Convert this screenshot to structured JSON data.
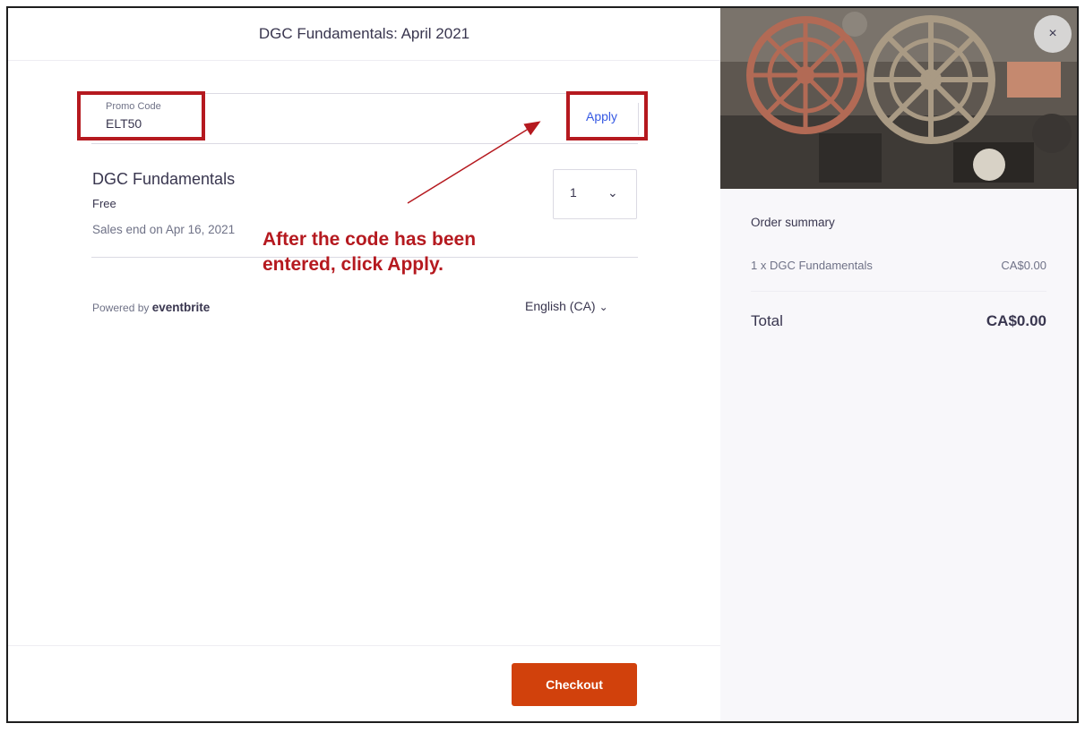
{
  "header": {
    "title": "DGC Fundamentals: April 2021"
  },
  "promo": {
    "label": "Promo Code",
    "value": "ELT50",
    "apply_label": "Apply"
  },
  "ticket": {
    "name": "DGC Fundamentals",
    "price": "Free",
    "sales_end": "Sales end on Apr 16, 2021",
    "quantity": "1"
  },
  "footer": {
    "powered_by": "Powered by",
    "brand": "eventbrite",
    "language": "English (CA)",
    "checkout_label": "Checkout"
  },
  "annotation": {
    "line1": "After the code has been",
    "line2": "entered, click Apply."
  },
  "order_summary": {
    "title": "Order summary",
    "item_label": "1 x DGC Fundamentals",
    "item_price": "CA$0.00",
    "total_label": "Total",
    "total_price": "CA$0.00"
  },
  "close_label": "×",
  "colors": {
    "accent": "#d1410c",
    "link": "#3659e3",
    "annotation": "#b5191f"
  }
}
